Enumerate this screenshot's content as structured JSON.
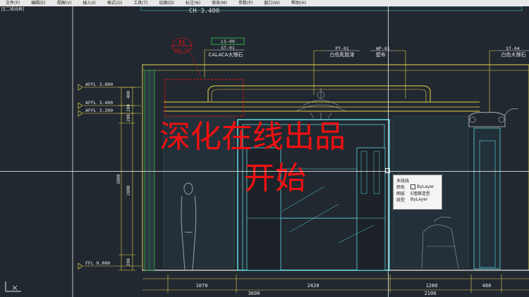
{
  "menubar": {
    "items": [
      "文件(F)",
      "编辑(E)",
      "视图(V)",
      "插入(I)",
      "格式(O)",
      "工具(T)",
      "绘图(D)",
      "标注(N)",
      "修改(M)",
      "参数(P)",
      "窗口(W)",
      "帮助(H)"
    ]
  },
  "viewport_label": "]][二维线框]",
  "header_text": "CH 3.400",
  "callout": {
    "number": "01",
    "ref": "1EL-27"
  },
  "materials": [
    {
      "code": "LS-09",
      "code2": "ST-01",
      "name": "CALACA大理石"
    },
    {
      "code": "PT-01",
      "name": "白色乳胶漆"
    },
    {
      "code": "WP-01",
      "name": "壁布"
    },
    {
      "code": "ST-04",
      "name": "白色大理石"
    }
  ],
  "levels": [
    "AFFL 3.800",
    "AFFL 3.400",
    "AFFL 3.200",
    "FFL 0.000"
  ],
  "vertical_dims": [
    "400",
    "200",
    "200",
    "3800",
    "2800",
    "200"
  ],
  "dims_row1": [
    "1070",
    "2420",
    "1280",
    "480"
  ],
  "dims_row2": [
    "3600",
    "2100"
  ],
  "watermark": {
    "line1": "深化在线出品",
    "line2": "开始"
  },
  "tooltip": {
    "title": "多段线",
    "rows": [
      {
        "key": "颜色",
        "value": "ByLayer"
      },
      {
        "key": "图层",
        "value": "E墙面造型"
      },
      {
        "key": "线型",
        "value": "ByLayer"
      }
    ]
  },
  "colors": {
    "background": "#212830",
    "yellow": "#e8d44a",
    "cyan": "#5fd8e0",
    "red": "#ee1111",
    "green": "#3ed04a"
  }
}
